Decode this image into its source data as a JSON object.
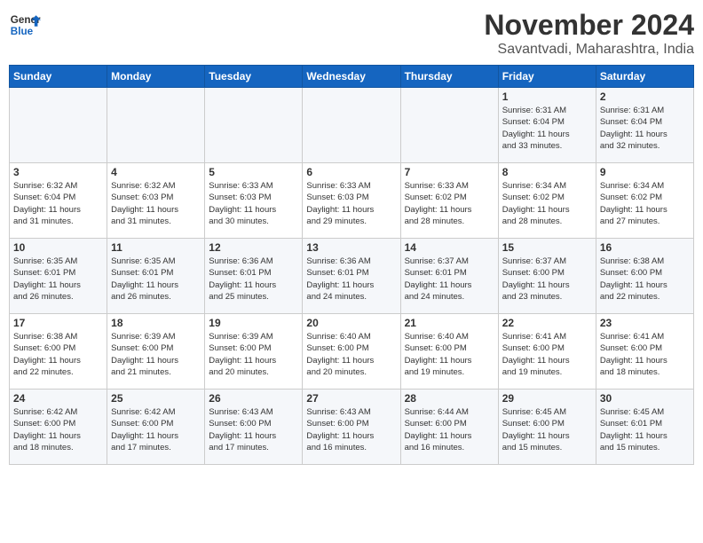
{
  "header": {
    "logo_line1": "General",
    "logo_line2": "Blue",
    "month": "November 2024",
    "location": "Savantvadi, Maharashtra, India"
  },
  "weekdays": [
    "Sunday",
    "Monday",
    "Tuesday",
    "Wednesday",
    "Thursday",
    "Friday",
    "Saturday"
  ],
  "weeks": [
    [
      {
        "day": "",
        "info": ""
      },
      {
        "day": "",
        "info": ""
      },
      {
        "day": "",
        "info": ""
      },
      {
        "day": "",
        "info": ""
      },
      {
        "day": "",
        "info": ""
      },
      {
        "day": "1",
        "info": "Sunrise: 6:31 AM\nSunset: 6:04 PM\nDaylight: 11 hours\nand 33 minutes."
      },
      {
        "day": "2",
        "info": "Sunrise: 6:31 AM\nSunset: 6:04 PM\nDaylight: 11 hours\nand 32 minutes."
      }
    ],
    [
      {
        "day": "3",
        "info": "Sunrise: 6:32 AM\nSunset: 6:04 PM\nDaylight: 11 hours\nand 31 minutes."
      },
      {
        "day": "4",
        "info": "Sunrise: 6:32 AM\nSunset: 6:03 PM\nDaylight: 11 hours\nand 31 minutes."
      },
      {
        "day": "5",
        "info": "Sunrise: 6:33 AM\nSunset: 6:03 PM\nDaylight: 11 hours\nand 30 minutes."
      },
      {
        "day": "6",
        "info": "Sunrise: 6:33 AM\nSunset: 6:03 PM\nDaylight: 11 hours\nand 29 minutes."
      },
      {
        "day": "7",
        "info": "Sunrise: 6:33 AM\nSunset: 6:02 PM\nDaylight: 11 hours\nand 28 minutes."
      },
      {
        "day": "8",
        "info": "Sunrise: 6:34 AM\nSunset: 6:02 PM\nDaylight: 11 hours\nand 28 minutes."
      },
      {
        "day": "9",
        "info": "Sunrise: 6:34 AM\nSunset: 6:02 PM\nDaylight: 11 hours\nand 27 minutes."
      }
    ],
    [
      {
        "day": "10",
        "info": "Sunrise: 6:35 AM\nSunset: 6:01 PM\nDaylight: 11 hours\nand 26 minutes."
      },
      {
        "day": "11",
        "info": "Sunrise: 6:35 AM\nSunset: 6:01 PM\nDaylight: 11 hours\nand 26 minutes."
      },
      {
        "day": "12",
        "info": "Sunrise: 6:36 AM\nSunset: 6:01 PM\nDaylight: 11 hours\nand 25 minutes."
      },
      {
        "day": "13",
        "info": "Sunrise: 6:36 AM\nSunset: 6:01 PM\nDaylight: 11 hours\nand 24 minutes."
      },
      {
        "day": "14",
        "info": "Sunrise: 6:37 AM\nSunset: 6:01 PM\nDaylight: 11 hours\nand 24 minutes."
      },
      {
        "day": "15",
        "info": "Sunrise: 6:37 AM\nSunset: 6:00 PM\nDaylight: 11 hours\nand 23 minutes."
      },
      {
        "day": "16",
        "info": "Sunrise: 6:38 AM\nSunset: 6:00 PM\nDaylight: 11 hours\nand 22 minutes."
      }
    ],
    [
      {
        "day": "17",
        "info": "Sunrise: 6:38 AM\nSunset: 6:00 PM\nDaylight: 11 hours\nand 22 minutes."
      },
      {
        "day": "18",
        "info": "Sunrise: 6:39 AM\nSunset: 6:00 PM\nDaylight: 11 hours\nand 21 minutes."
      },
      {
        "day": "19",
        "info": "Sunrise: 6:39 AM\nSunset: 6:00 PM\nDaylight: 11 hours\nand 20 minutes."
      },
      {
        "day": "20",
        "info": "Sunrise: 6:40 AM\nSunset: 6:00 PM\nDaylight: 11 hours\nand 20 minutes."
      },
      {
        "day": "21",
        "info": "Sunrise: 6:40 AM\nSunset: 6:00 PM\nDaylight: 11 hours\nand 19 minutes."
      },
      {
        "day": "22",
        "info": "Sunrise: 6:41 AM\nSunset: 6:00 PM\nDaylight: 11 hours\nand 19 minutes."
      },
      {
        "day": "23",
        "info": "Sunrise: 6:41 AM\nSunset: 6:00 PM\nDaylight: 11 hours\nand 18 minutes."
      }
    ],
    [
      {
        "day": "24",
        "info": "Sunrise: 6:42 AM\nSunset: 6:00 PM\nDaylight: 11 hours\nand 18 minutes."
      },
      {
        "day": "25",
        "info": "Sunrise: 6:42 AM\nSunset: 6:00 PM\nDaylight: 11 hours\nand 17 minutes."
      },
      {
        "day": "26",
        "info": "Sunrise: 6:43 AM\nSunset: 6:00 PM\nDaylight: 11 hours\nand 17 minutes."
      },
      {
        "day": "27",
        "info": "Sunrise: 6:43 AM\nSunset: 6:00 PM\nDaylight: 11 hours\nand 16 minutes."
      },
      {
        "day": "28",
        "info": "Sunrise: 6:44 AM\nSunset: 6:00 PM\nDaylight: 11 hours\nand 16 minutes."
      },
      {
        "day": "29",
        "info": "Sunrise: 6:45 AM\nSunset: 6:00 PM\nDaylight: 11 hours\nand 15 minutes."
      },
      {
        "day": "30",
        "info": "Sunrise: 6:45 AM\nSunset: 6:01 PM\nDaylight: 11 hours\nand 15 minutes."
      }
    ]
  ]
}
